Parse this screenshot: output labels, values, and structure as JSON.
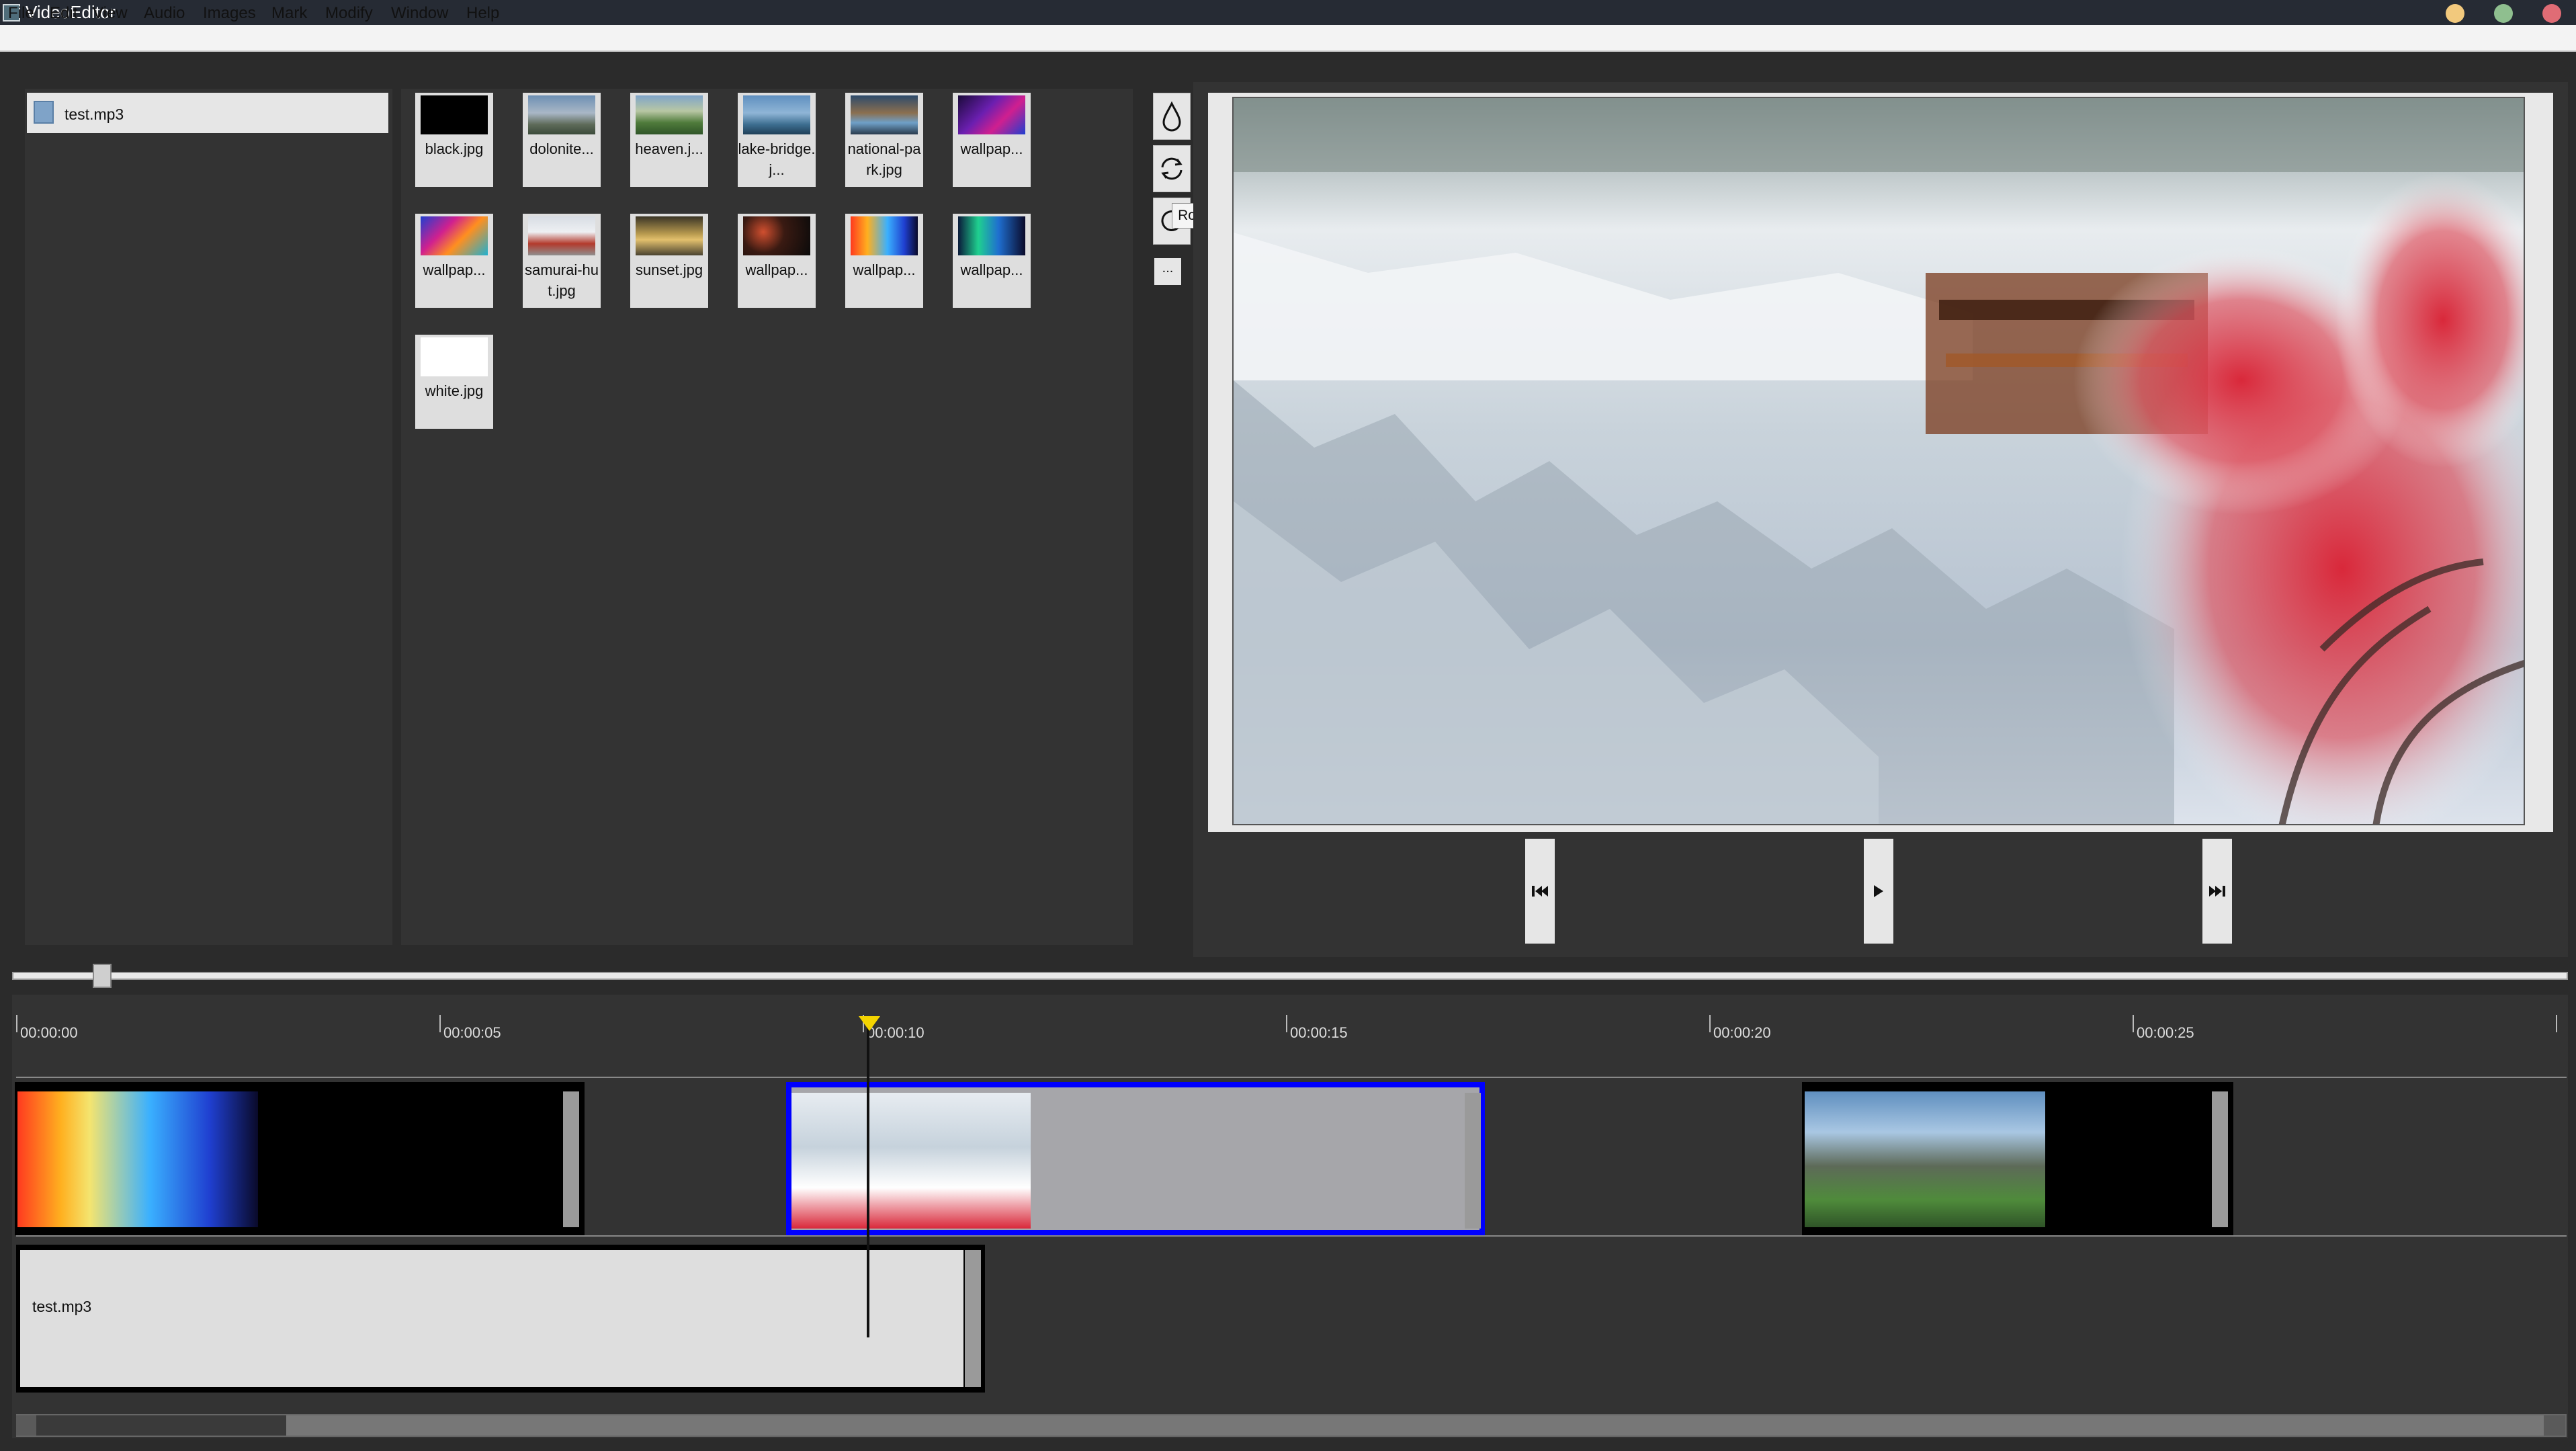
{
  "window": {
    "title": "VideoEditor"
  },
  "menu": [
    "File",
    "Edit",
    "View",
    "Audio",
    "Images",
    "Mark",
    "Modify",
    "Window",
    "Help"
  ],
  "project_files": [
    {
      "name": "test.mp3",
      "icon": "audio-file-icon"
    }
  ],
  "library": [
    {
      "label": "black.jpg"
    },
    {
      "label": "dolonite..."
    },
    {
      "label": "heaven.j..."
    },
    {
      "label": "lake-bridge.j..."
    },
    {
      "label": "national-park.jpg"
    },
    {
      "label": "wallpap..."
    },
    {
      "label": "wallpap..."
    },
    {
      "label": "samurai-hut.jpg"
    },
    {
      "label": "sunset.jpg"
    },
    {
      "label": "wallpap..."
    },
    {
      "label": "wallpap..."
    },
    {
      "label": "wallpap..."
    },
    {
      "label": "white.jpg"
    }
  ],
  "tools": {
    "items": [
      "water-drop-icon",
      "sync-icon",
      "rotate-icon"
    ],
    "tooltip": "Rotate",
    "more": "..."
  },
  "transport": [
    "skip-previous-icon",
    "play-icon",
    "skip-next-icon"
  ],
  "timeline": {
    "ticks": [
      "00:00:00",
      "00:00:05",
      "00:00:10",
      "00:00:15",
      "00:00:20",
      "00:00:25"
    ],
    "audio_clip": "test.mp3"
  },
  "colors": {
    "selection": "#0000ff",
    "playhead": "#f4d400",
    "panel": "#333333"
  }
}
